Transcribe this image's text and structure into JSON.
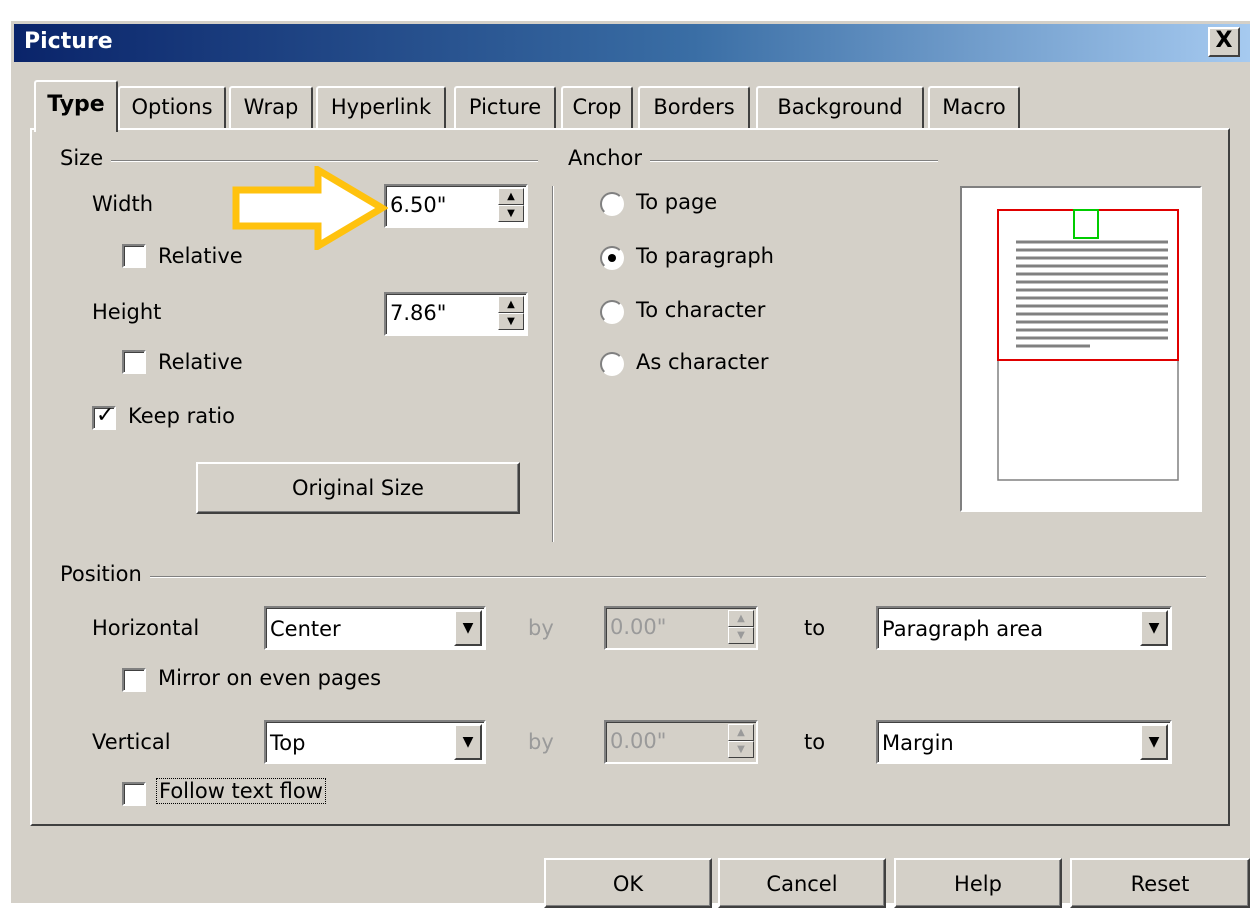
{
  "window": {
    "title": "Picture",
    "close_label": "X"
  },
  "tabs": [
    {
      "label": "Type",
      "active": true
    },
    {
      "label": "Options"
    },
    {
      "label": "Wrap"
    },
    {
      "label": "Hyperlink"
    },
    {
      "label": "Picture"
    },
    {
      "label": "Crop"
    },
    {
      "label": "Borders"
    },
    {
      "label": "Background"
    },
    {
      "label": "Macro"
    }
  ],
  "size": {
    "group_label": "Size",
    "width_label": "Width",
    "width_value": "6.50\"",
    "width_relative_label": "Relative",
    "width_relative_checked": false,
    "height_label": "Height",
    "height_value": "7.86\"",
    "height_relative_label": "Relative",
    "height_relative_checked": false,
    "keep_ratio_label": "Keep ratio",
    "keep_ratio_checked": true,
    "original_size_label": "Original Size"
  },
  "anchor": {
    "group_label": "Anchor",
    "options": [
      {
        "label": "To page",
        "selected": false
      },
      {
        "label": "To paragraph",
        "selected": true
      },
      {
        "label": "To character",
        "selected": false
      },
      {
        "label": "As character",
        "selected": false
      }
    ]
  },
  "position": {
    "group_label": "Position",
    "horizontal_label": "Horizontal",
    "horizontal_value": "Center",
    "horizontal_by_label": "by",
    "horizontal_by_value": "0.00\"",
    "horizontal_to_label": "to",
    "horizontal_to_value": "Paragraph area",
    "mirror_label": "Mirror on even pages",
    "vertical_label": "Vertical",
    "vertical_value": "Top",
    "vertical_by_label": "by",
    "vertical_by_value": "0.00\"",
    "vertical_to_label": "to",
    "vertical_to_value": "Margin",
    "follow_text_flow_label": "Follow text flow"
  },
  "buttons": {
    "ok": "OK",
    "cancel": "Cancel",
    "help": "Help",
    "reset": "Reset"
  },
  "colors": {
    "title_bar_start": "#0a246a",
    "annotation_arrow": "#ffc20e",
    "preview_frame": "#e00000",
    "preview_object": "#00cc00"
  }
}
